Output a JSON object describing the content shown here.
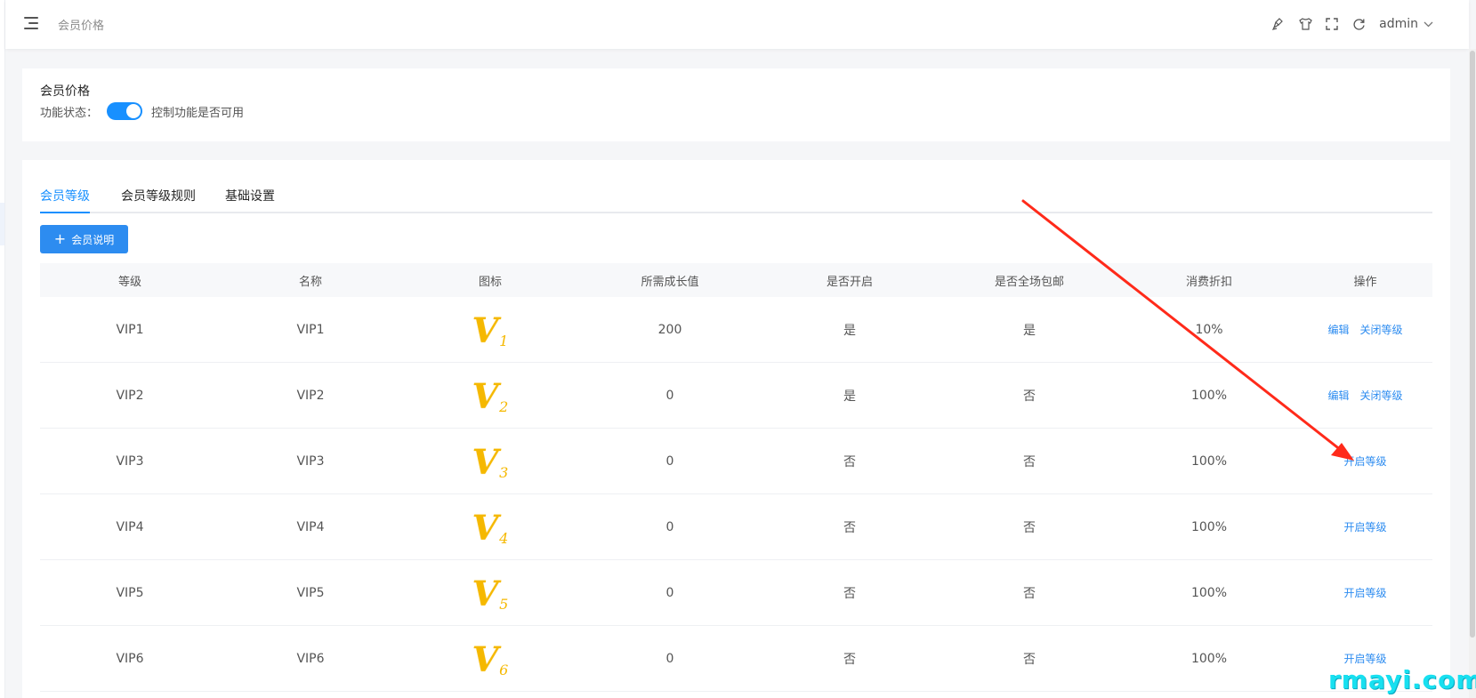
{
  "header": {
    "breadcrumb": "会员价格",
    "user": "admin",
    "icons": [
      "brush-icon",
      "shirt-icon",
      "fullscreen-icon",
      "refresh-icon"
    ]
  },
  "status_card": {
    "title": "会员价格",
    "status_label": "功能状态：",
    "switch_on": true,
    "status_desc": "控制功能是否可用"
  },
  "tabs": [
    {
      "label": "会员等级",
      "active": true
    },
    {
      "label": "会员等级规则",
      "active": false
    },
    {
      "label": "基础设置",
      "active": false
    }
  ],
  "add_button": {
    "icon": "plus-icon",
    "label": "会员说明"
  },
  "table": {
    "columns": [
      "等级",
      "名称",
      "图标",
      "所需成长值",
      "是否开启",
      "是否全场包邮",
      "消费折扣",
      "操作"
    ],
    "rows": [
      {
        "level": "VIP1",
        "name": "VIP1",
        "icon_num": "1",
        "growth": "200",
        "enabled": "是",
        "free_shipping": "是",
        "discount": "10%",
        "actions": [
          "编辑",
          "关闭等级"
        ]
      },
      {
        "level": "VIP2",
        "name": "VIP2",
        "icon_num": "2",
        "growth": "0",
        "enabled": "是",
        "free_shipping": "否",
        "discount": "100%",
        "actions": [
          "编辑",
          "关闭等级"
        ]
      },
      {
        "level": "VIP3",
        "name": "VIP3",
        "icon_num": "3",
        "growth": "0",
        "enabled": "否",
        "free_shipping": "否",
        "discount": "100%",
        "actions": [
          "开启等级"
        ]
      },
      {
        "level": "VIP4",
        "name": "VIP4",
        "icon_num": "4",
        "growth": "0",
        "enabled": "否",
        "free_shipping": "否",
        "discount": "100%",
        "actions": [
          "开启等级"
        ]
      },
      {
        "level": "VIP5",
        "name": "VIP5",
        "icon_num": "5",
        "growth": "0",
        "enabled": "否",
        "free_shipping": "否",
        "discount": "100%",
        "actions": [
          "开启等级"
        ]
      },
      {
        "level": "VIP6",
        "name": "VIP6",
        "icon_num": "6",
        "growth": "0",
        "enabled": "否",
        "free_shipping": "否",
        "discount": "100%",
        "actions": [
          "开启等级"
        ]
      }
    ]
  },
  "icon_letter": "V",
  "watermark": "rmayi.com",
  "colors": {
    "primary": "#1890ff",
    "button": "#2d8cf0",
    "gold": "#f5b800",
    "arrow": "#ff2a1a",
    "watermark": "#18e0f0"
  }
}
